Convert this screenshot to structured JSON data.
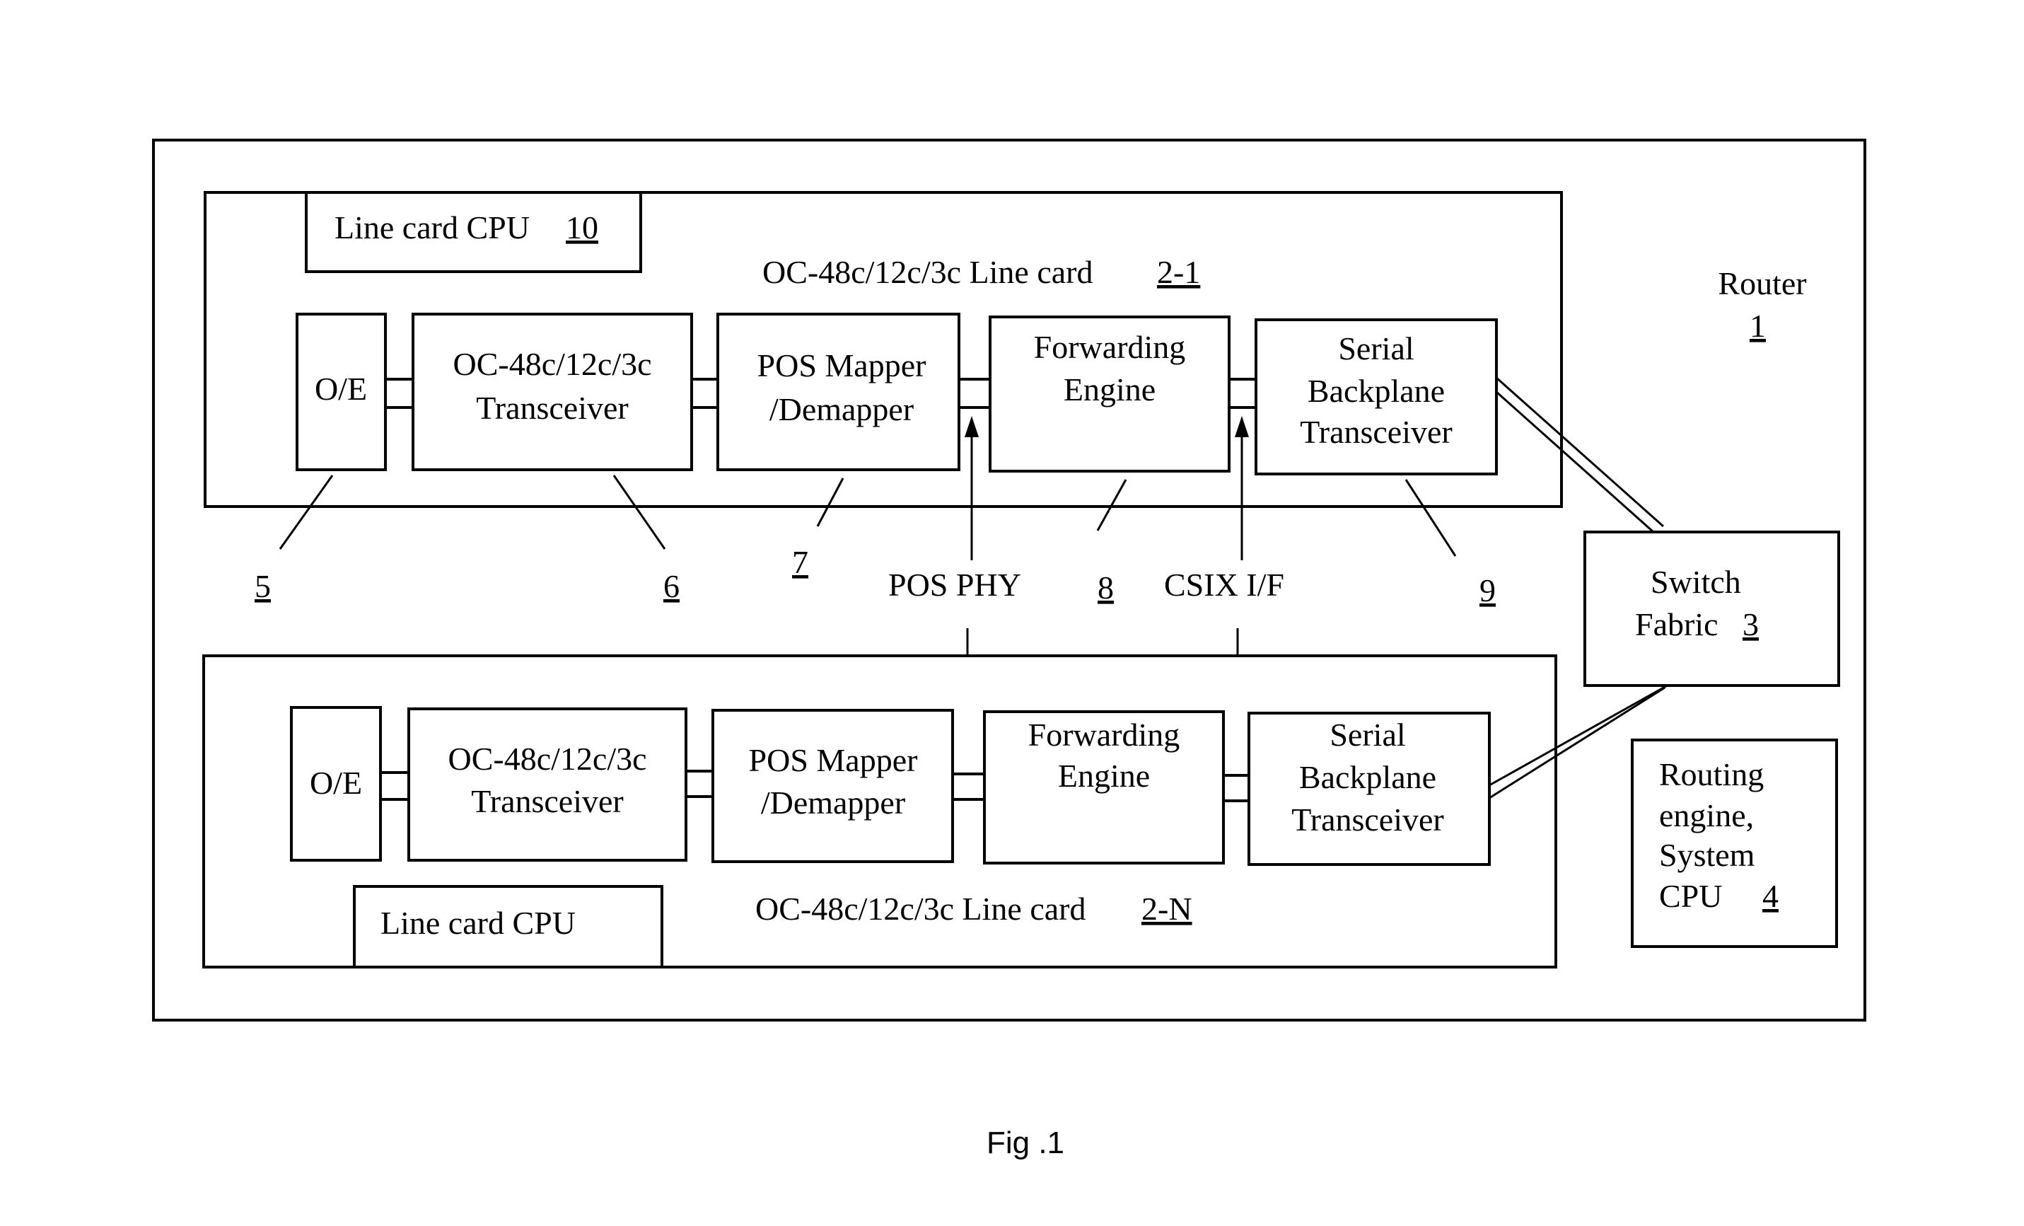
{
  "figure": {
    "caption": "Fig .1"
  },
  "router": {
    "label": "Router",
    "ref": "1"
  },
  "switch_fabric": {
    "line1": "Switch",
    "line2": "Fabric",
    "ref": "3"
  },
  "routing_engine": {
    "line1": "Routing",
    "line2": "engine,",
    "line3": "System",
    "line4": "CPU",
    "ref": "4"
  },
  "line_card_top": {
    "title": "OC-48c/12c/3c Line card",
    "ref": "2-1",
    "cpu_label": "Line card CPU",
    "cpu_ref": "10",
    "blocks": {
      "oe": "O/E",
      "transceiver_l1": "OC-48c/12c/3c",
      "transceiver_l2": "Transceiver",
      "pos_l1": "POS Mapper",
      "pos_l2": "/Demapper",
      "fe_l1": "Forwarding",
      "fe_l2": "Engine",
      "sbt_l1": "Serial",
      "sbt_l2": "Backplane",
      "sbt_l3": "Transceiver"
    }
  },
  "line_card_bottom": {
    "title": "OC-48c/12c/3c Line card",
    "ref": "2-N",
    "cpu_label": "Line card CPU",
    "blocks": {
      "oe": "O/E",
      "transceiver_l1": "OC-48c/12c/3c",
      "transceiver_l2": "Transceiver",
      "pos_l1": "POS Mapper",
      "pos_l2": "/Demapper",
      "fe_l1": "Forwarding",
      "fe_l2": "Engine",
      "sbt_l1": "Serial",
      "sbt_l2": "Backplane",
      "sbt_l3": "Transceiver"
    }
  },
  "interfaces": {
    "pos_phy": "POS PHY",
    "csix": "CSIX I/F"
  },
  "callouts": {
    "oe": "5",
    "transceiver": "6",
    "pos_mapper": "7",
    "forwarding_engine": "8",
    "serial_backplane": "9"
  }
}
